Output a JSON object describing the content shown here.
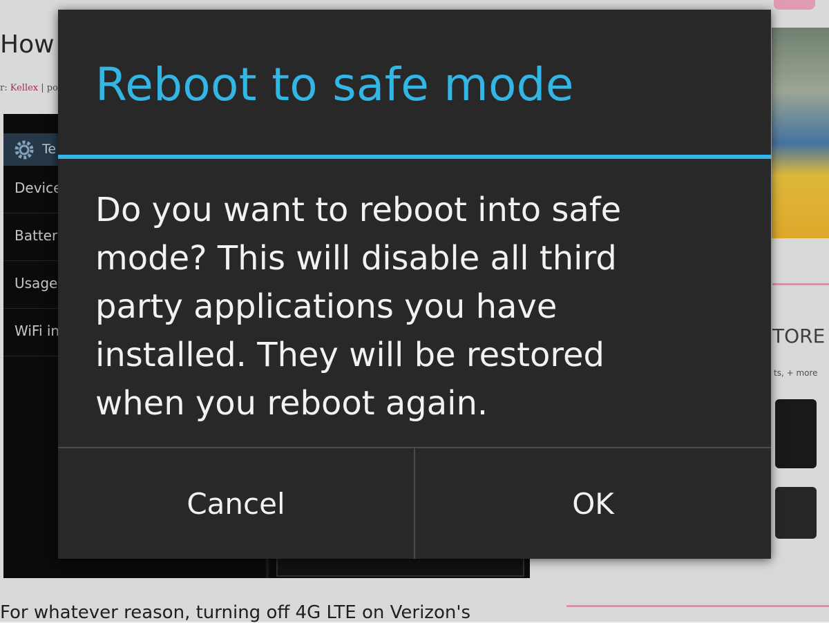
{
  "background_page": {
    "article_title": "How t",
    "byline_prefix": "r: ",
    "byline_author": "Kellex",
    "byline_suffix": " | pos",
    "settings_header_text": "Te",
    "settings_items": [
      "Device",
      "Batter",
      "Usage",
      "WiFi in"
    ],
    "article_text": "For whatever reason, turning off 4G LTE on Verizon's",
    "sidebar_store_heading": "TORE",
    "sidebar_store_sub": "ts, + more"
  },
  "dialog": {
    "title": "Reboot to safe mode",
    "message": "Do you want to reboot into safe\nmode? This will disable all third\nparty applications you have\ninstalled. They will be restored\nwhen you reboot again.",
    "cancel_label": "Cancel",
    "ok_label": "OK"
  },
  "colors": {
    "accent": "#33b5e5",
    "dialog_bg": "#282828",
    "text": "#f2f2f2"
  }
}
